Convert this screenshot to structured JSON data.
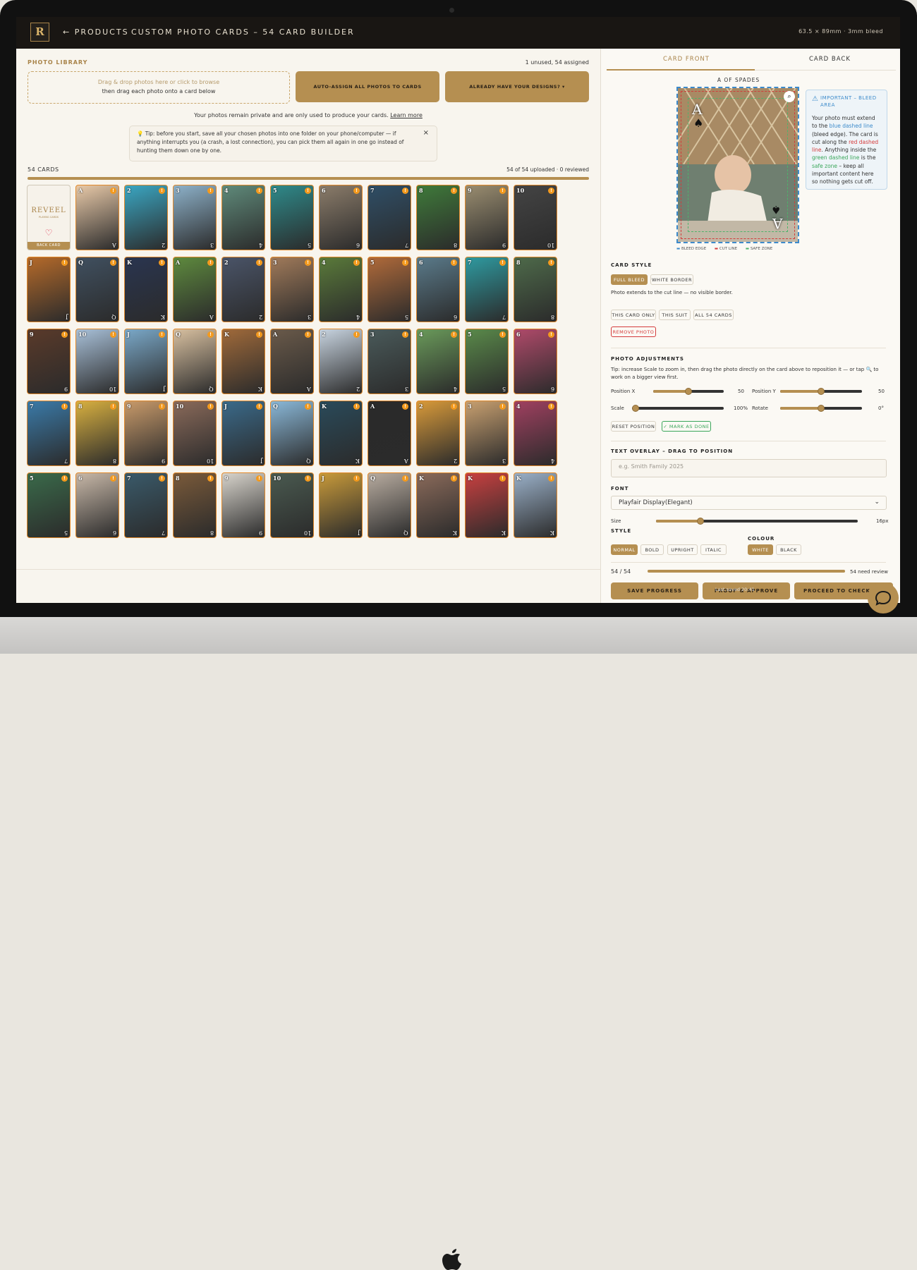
{
  "header": {
    "logo_text": "R",
    "back_label": "← PRODUCTS",
    "breadcrumb": "CUSTOM PHOTO CARDS – 54 CARD BUILDER",
    "dimensions": "63.5 × 89mm · 3mm bleed"
  },
  "library": {
    "title": "PHOTO LIBRARY",
    "status": "1 unused, 54 assigned",
    "dropzone_line1": "Drag & drop photos here or click to browse",
    "dropzone_line2": "then drag each photo onto a card below",
    "auto_assign_label": "AUTO-ASSIGN ALL PHOTOS TO CARDS",
    "have_designs_label": "ALREADY HAVE YOUR DESIGNS? ▾",
    "privacy_text": "Your photos remain private and are only used to produce your cards.",
    "learn_more": "Learn more",
    "tip_text": "💡 Tip: before you start, save all your chosen photos into one folder on your phone/computer — if anything interrupts you (a crash, a lost connection), you can pick them all again in one go instead of hunting them down one by one.",
    "tip_close": "×"
  },
  "cards": {
    "title": "54 CARDS",
    "progress_text": "54 of 54 uploaded · 0 reviewed",
    "back_card": {
      "brand": "REVEEL",
      "sub": "PLAYING CARDS",
      "heart": "♡",
      "label": "BACK CARD"
    },
    "items": [
      {
        "rank": "A",
        "color": "#e8c9a8"
      },
      {
        "rank": "2",
        "color": "#3aa6c2"
      },
      {
        "rank": "3",
        "color": "#8db1c9"
      },
      {
        "rank": "4",
        "color": "#5f8a7a"
      },
      {
        "rank": "5",
        "color": "#2e8a8a"
      },
      {
        "rank": "6",
        "color": "#8b7c6a"
      },
      {
        "rank": "7",
        "color": "#2f4e66"
      },
      {
        "rank": "8",
        "color": "#3f7a3a"
      },
      {
        "rank": "9",
        "color": "#9a8d70"
      },
      {
        "rank": "10",
        "color": "#444444"
      },
      {
        "rank": "J",
        "color": "#b56a2a"
      },
      {
        "rank": "Q",
        "color": "#405060"
      },
      {
        "rank": "K",
        "color": "#2a3550"
      },
      {
        "rank": "A",
        "color": "#5e8a3e"
      },
      {
        "rank": "2",
        "color": "#4a5468"
      },
      {
        "rank": "3",
        "color": "#a07a5a"
      },
      {
        "rank": "4",
        "color": "#5a7a3a"
      },
      {
        "rank": "5",
        "color": "#b06a3a"
      },
      {
        "rank": "6",
        "color": "#5a7a8a"
      },
      {
        "rank": "7",
        "color": "#2e9aa0"
      },
      {
        "rank": "8",
        "color": "#4e6a4a"
      },
      {
        "rank": "9",
        "color": "#5a3a2a"
      },
      {
        "rank": "10",
        "color": "#a8c0d8"
      },
      {
        "rank": "J",
        "color": "#7aa8c8"
      },
      {
        "rank": "Q",
        "color": "#d8c0a0"
      },
      {
        "rank": "K",
        "color": "#a06a3a"
      },
      {
        "rank": "A",
        "color": "#6a5a4a"
      },
      {
        "rank": "2",
        "color": "#c8d4e0"
      },
      {
        "rank": "3",
        "color": "#4a5a5a"
      },
      {
        "rank": "4",
        "color": "#6a9a5a"
      },
      {
        "rank": "5",
        "color": "#5a8a4a"
      },
      {
        "rank": "6",
        "color": "#b04a6a"
      },
      {
        "rank": "7",
        "color": "#3a7aa8"
      },
      {
        "rank": "8",
        "color": "#d8b040"
      },
      {
        "rank": "9",
        "color": "#c89a6a"
      },
      {
        "rank": "10",
        "color": "#8a6a5a"
      },
      {
        "rank": "J",
        "color": "#3a6a8a"
      },
      {
        "rank": "Q",
        "color": "#8ab8d8"
      },
      {
        "rank": "K",
        "color": "#2a4a5a"
      },
      {
        "rank": "A",
        "color": "#2a2a2a"
      },
      {
        "rank": "2",
        "color": "#d89a3a"
      },
      {
        "rank": "3",
        "color": "#c8a070"
      },
      {
        "rank": "4",
        "color": "#a04060"
      },
      {
        "rank": "5",
        "color": "#3a6a4a"
      },
      {
        "rank": "6",
        "color": "#c8b8a8"
      },
      {
        "rank": "7",
        "color": "#3a5a6a"
      },
      {
        "rank": "8",
        "color": "#7a5a3a"
      },
      {
        "rank": "9",
        "color": "#d8d4cc"
      },
      {
        "rank": "10",
        "color": "#4a5a50"
      },
      {
        "rank": "J",
        "color": "#c89a3a"
      },
      {
        "rank": "Q",
        "color": "#b8aca0"
      },
      {
        "rank": "K",
        "color": "#8a6a5a"
      },
      {
        "rank": "K",
        "color": "#c84040"
      },
      {
        "rank": "K",
        "color": "#9ab0c8"
      }
    ]
  },
  "editor": {
    "tab_front": "CARD FRONT",
    "tab_back": "CARD BACK",
    "card_name": "A OF SPADES",
    "preview_rank": "A",
    "preview_suit": "♠",
    "legend": [
      "BLEED EDGE",
      "CUT LINE",
      "SAFE ZONE"
    ],
    "info_title": "IMPORTANT – BLEED AREA",
    "info_parts": [
      {
        "t": "Your photo must extend to the ",
        "c": "#333"
      },
      {
        "t": "blue dashed line",
        "c": "#3d8bcb"
      },
      {
        "t": " (bleed edge). The card is cut along the ",
        "c": "#333"
      },
      {
        "t": "red dashed line",
        "c": "#d43b3b"
      },
      {
        "t": ". Anything inside the ",
        "c": "#333"
      },
      {
        "t": "green dashed line",
        "c": "#3aa65a"
      },
      {
        "t": " is the ",
        "c": "#333"
      },
      {
        "t": "safe zone",
        "c": "#3aa65a"
      },
      {
        "t": " – keep all important content here so nothing gets cut off.",
        "c": "#333"
      }
    ],
    "card_style_label": "CARD STYLE",
    "full_bleed": "FULL BLEED",
    "white_border": "WHITE BORDER",
    "style_note": "Photo extends to the cut line — no visible border.",
    "apply_this_card": "THIS CARD ONLY",
    "apply_this_suit": "THIS SUIT",
    "apply_all": "ALL 54 CARDS",
    "remove_photo": "REMOVE PHOTO",
    "adjust_label": "PHOTO ADJUSTMENTS",
    "adjust_tip_pre": "Tip: increase Scale to zoom in, then drag the photo directly on the card above to reposition it — or tap",
    "adjust_tip_post": "to work on a bigger view first.",
    "posx_label": "Position X",
    "posx_value": "50",
    "posx": 0.5,
    "posy_label": "Position Y",
    "posy_value": "50",
    "posy": 0.5,
    "scale_label": "Scale",
    "scale_value": "100%",
    "scale": 0.0,
    "rotate_label": "Rotate",
    "rotate_value": "0°",
    "rotate": 0.5,
    "reset_label": "RESET POSITION",
    "done_label": "✓ MARK AS DONE",
    "overlay_label": "TEXT OVERLAY – DRAG TO POSITION",
    "overlay_placeholder": "e.g. Smith Family 2025",
    "font_label": "FONT",
    "font_value": "Playfair Display(Elegant)",
    "size_label": "Size",
    "size_value": "16px",
    "size": 0.22,
    "style_label": "STYLE",
    "styles": [
      "NORMAL",
      "BOLD",
      "UPRIGHT",
      "ITALIC"
    ],
    "colour_label": "COLOUR",
    "colours": [
      "WHITE",
      "BLACK"
    ],
    "review_count": "54 / 54",
    "review_progress": 1.0,
    "review_text": "54 need review",
    "save_label": "SAVE PROGRESS",
    "proof_label": "PROOF & APPROVE",
    "checkout_label": "PROCEED TO CHECKOUT",
    "last_saved": "Last saved 20:41"
  }
}
